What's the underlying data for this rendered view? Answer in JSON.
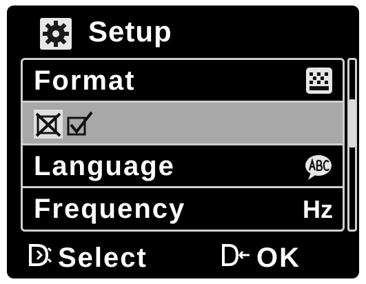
{
  "header": {
    "title": "Setup",
    "icon": "gear-icon"
  },
  "menu": {
    "items": [
      {
        "label": "Format",
        "icon": "format-grid-icon"
      },
      {
        "icon_left": "cross-box-icon",
        "icon_right": "check-box-icon",
        "selected": true
      },
      {
        "label": "Language",
        "icon": "abc-bubble-icon"
      },
      {
        "label": "Frequency",
        "value": "Hz"
      }
    ]
  },
  "footer": {
    "select_label": "Select",
    "ok_label": "OK"
  },
  "colors": {
    "background": "#000000",
    "selected_row": "#a8a8a8",
    "text": "#ffffff",
    "border": "#cfcfcf"
  }
}
